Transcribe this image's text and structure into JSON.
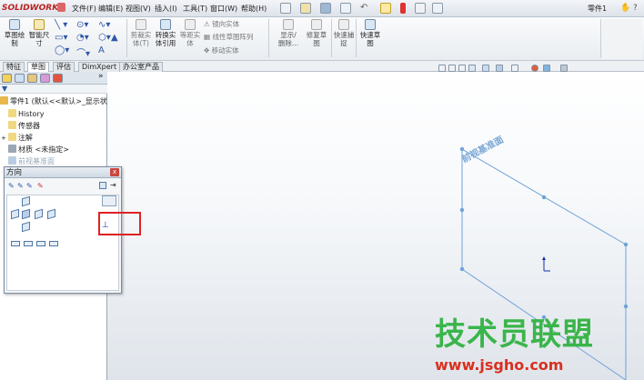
{
  "app": {
    "logo": "SOLIDWORKS",
    "document_title": "零件1"
  },
  "menu": [
    "文件(F)",
    "编辑(E)",
    "视图(V)",
    "插入(I)",
    "工具(T)",
    "窗口(W)",
    "帮助(H)"
  ],
  "ribbon": {
    "sketch": "草图绘\n制",
    "smart_dim": "智能尺\n寸",
    "trim": "剪裁实\n体(T)",
    "convert": "转换实\n体引用",
    "offset": "等距实\n体",
    "mirror": "镜向实体",
    "linear_pattern": "线性草图阵列",
    "move": "移动实体",
    "display_delete": "显示/\n删除...",
    "repair": "修复草\n图",
    "quick_snap": "快速捕\n捉",
    "rapid_sketch": "快速草\n图"
  },
  "tabs": [
    "特征",
    "草图",
    "评估",
    "DimXpert",
    "办公室产品"
  ],
  "tree": {
    "part": "零件1  (默认<<默认>_显示状",
    "history": "History",
    "sensors": "传感器",
    "annotations": "注解",
    "material": "材质 <未指定>",
    "front_plane": "前视基准面"
  },
  "popup": {
    "title": "方向",
    "close": "x"
  },
  "canvas": {
    "plane_label": "前视基准面"
  },
  "watermark": {
    "cn": "技术员联盟",
    "url": "www.jsgho.com"
  }
}
